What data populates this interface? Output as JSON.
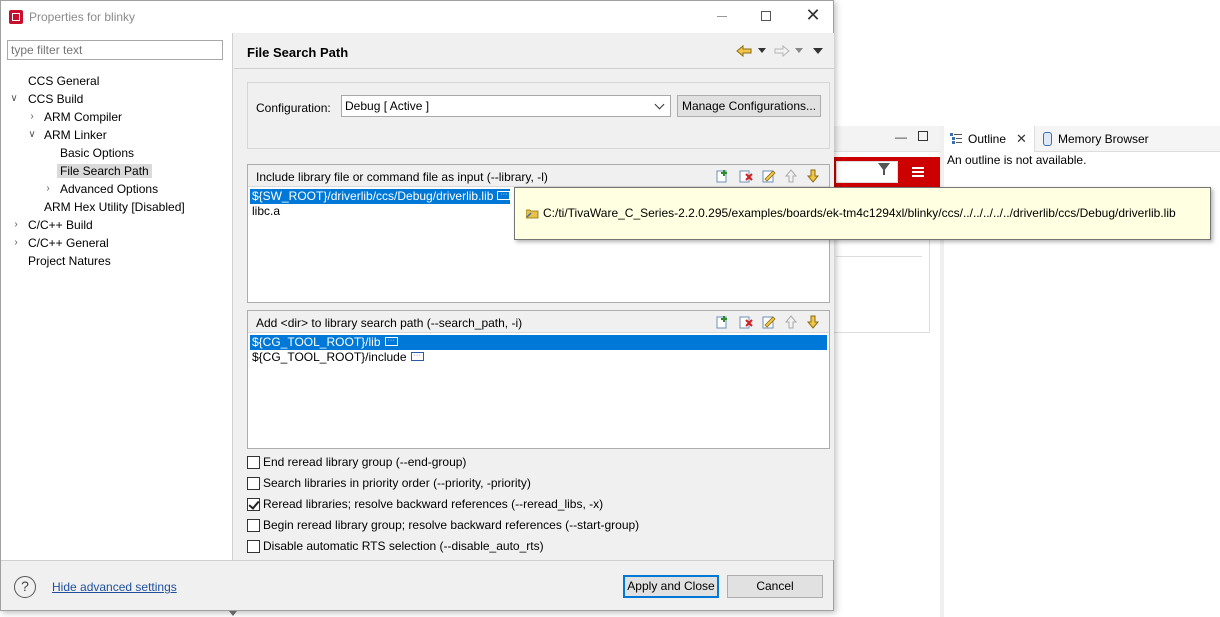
{
  "window": {
    "title": "Properties for blinky",
    "minimize": "—",
    "maximize": "",
    "close": "✕"
  },
  "filter": {
    "placeholder": "type filter text"
  },
  "tree": [
    {
      "label": "CCS General",
      "expander": "",
      "selected": false
    },
    {
      "label": "CCS Build",
      "expander": "expanded",
      "selected": false
    },
    {
      "label": "ARM Compiler",
      "expander": "collapsed",
      "selected": false
    },
    {
      "label": "ARM Linker",
      "expander": "expanded",
      "selected": false
    },
    {
      "label": "Basic Options",
      "expander": "",
      "selected": false
    },
    {
      "label": "File Search Path",
      "expander": "",
      "selected": true
    },
    {
      "label": "Advanced Options",
      "expander": "collapsed",
      "selected": false
    },
    {
      "label": "ARM Hex Utility  [Disabled]",
      "expander": "",
      "selected": false
    },
    {
      "label": "C/C++ Build",
      "expander": "collapsed",
      "selected": false
    },
    {
      "label": "C/C++ General",
      "expander": "collapsed",
      "selected": false
    },
    {
      "label": "Project Natures",
      "expander": "",
      "selected": false
    }
  ],
  "page": {
    "title": "File Search Path"
  },
  "config": {
    "label": "Configuration:",
    "value": "Debug  [ Active ]",
    "manage_label": "Manage Configurations..."
  },
  "library_list": {
    "header": "Include library file or command file as input (--library, -l)",
    "items": [
      {
        "text": "${SW_ROOT}/driverlib/ccs/Debug/driverlib.lib",
        "selected": true,
        "more": "···"
      },
      {
        "text": "libc.a",
        "selected": false,
        "more": ""
      }
    ]
  },
  "search_path_list": {
    "header": "Add <dir> to library search path (--search_path, -i)",
    "items": [
      {
        "text": "${CG_TOOL_ROOT}/lib",
        "selected": true,
        "more": "···"
      },
      {
        "text": "${CG_TOOL_ROOT}/include",
        "selected": false,
        "more": "···"
      }
    ]
  },
  "list_tools": [
    "add-icon",
    "delete-icon",
    "edit-icon",
    "move-up-icon",
    "move-down-icon"
  ],
  "options": [
    {
      "label": "End reread library group (--end-group)",
      "checked": false
    },
    {
      "label": "Search libraries in priority order (--priority, -priority)",
      "checked": false
    },
    {
      "label": "Reread libraries; resolve backward references (--reread_libs, -x)",
      "checked": true
    },
    {
      "label": "Begin reread library group; resolve backward references (--start-group)",
      "checked": false
    },
    {
      "label": "Disable automatic RTS selection (--disable_auto_rts)",
      "checked": false
    }
  ],
  "footer": {
    "help": "?",
    "hide_advanced": "Hide advanced settings",
    "apply_close": "Apply and Close",
    "cancel": "Cancel"
  },
  "tooltip": {
    "text": "C:/ti/TivaWare_C_Series-2.2.0.295/examples/boards/ek-tm4c1294xl/blinky/ccs/../../../../../driverlib/ccs/Debug/driverlib.lib"
  },
  "background": {
    "outline_tab": "Outline",
    "memory_tab": "Memory Browser",
    "outline_message": "An outline is not available.",
    "minimize": "—"
  },
  "colors": {
    "selection": "#0078d7",
    "accent_red": "#cc0000",
    "tooltip_bg": "#ffffe1",
    "link": "#1f4f9c"
  }
}
